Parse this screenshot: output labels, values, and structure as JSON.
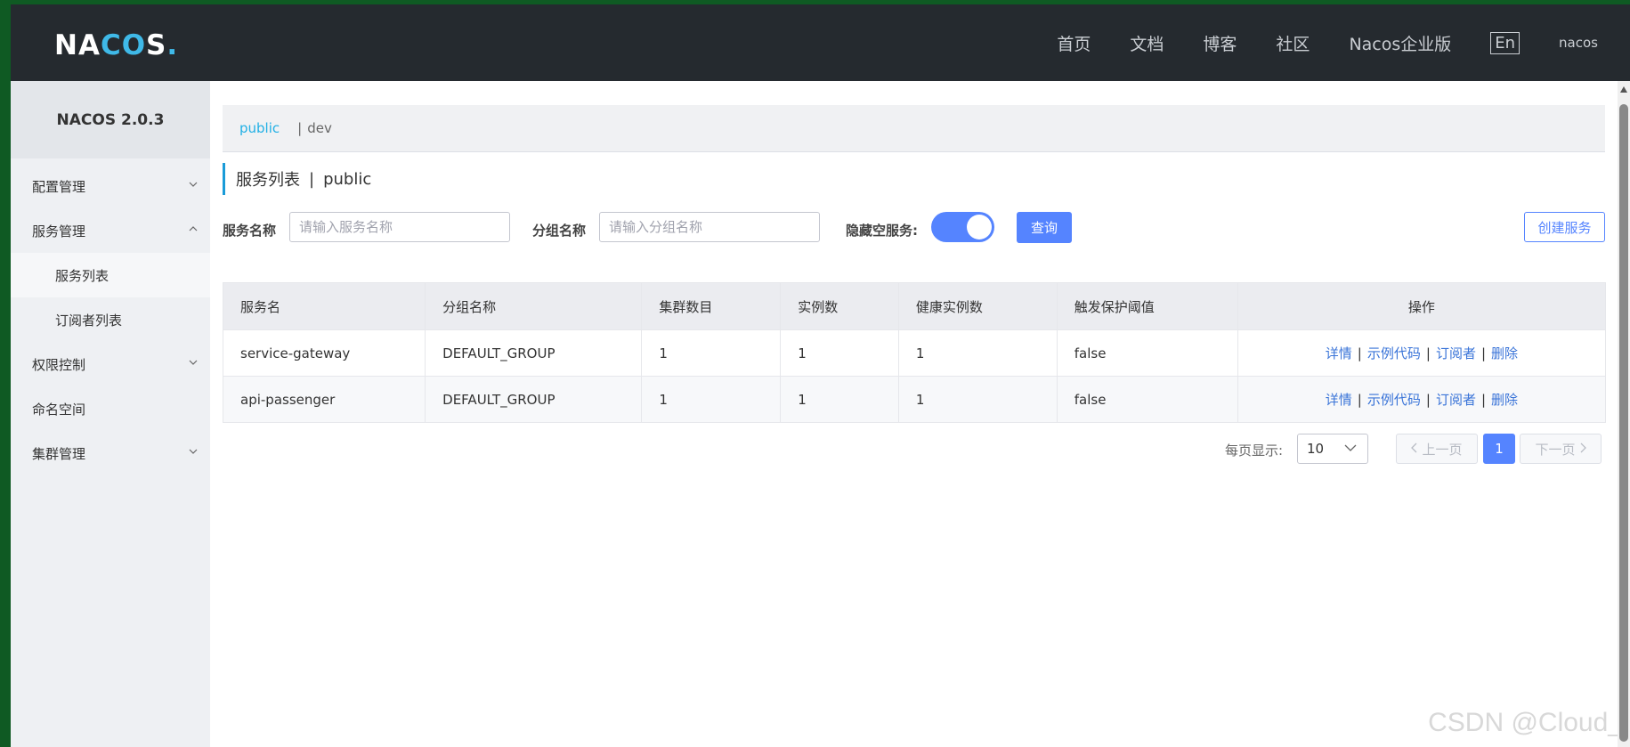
{
  "header": {
    "logo": {
      "pre": "NA",
      "accent": "CO",
      "post": "S",
      "dot": "."
    },
    "nav": [
      "首页",
      "文档",
      "博客",
      "社区",
      "Nacos企业版"
    ],
    "lang": "En",
    "user": "nacos"
  },
  "sidebar": {
    "title": "NACOS 2.0.3",
    "menu": {
      "config": "配置管理",
      "service": "服务管理",
      "service_list": "服务列表",
      "subscriber_list": "订阅者列表",
      "auth": "权限控制",
      "namespace": "命名空间",
      "cluster": "集群管理"
    }
  },
  "namespace_bar": {
    "active": "public",
    "sep": "|",
    "other": "dev"
  },
  "page_title": {
    "title": "服务列表",
    "sep": "|",
    "namespace": "public"
  },
  "filters": {
    "service_name_label": "服务名称",
    "service_name_placeholder": "请输入服务名称",
    "group_name_label": "分组名称",
    "group_name_placeholder": "请输入分组名称",
    "hide_empty_label": "隐藏空服务:",
    "hide_empty_on": true,
    "query_button": "查询",
    "create_button": "创建服务"
  },
  "table": {
    "headers": [
      "服务名",
      "分组名称",
      "集群数目",
      "实例数",
      "健康实例数",
      "触发保护阈值",
      "操作"
    ],
    "rows": [
      {
        "name": "service-gateway",
        "group": "DEFAULT_GROUP",
        "clusters": "1",
        "instances": "1",
        "healthy": "1",
        "threshold": "false"
      },
      {
        "name": "api-passenger",
        "group": "DEFAULT_GROUP",
        "clusters": "1",
        "instances": "1",
        "healthy": "1",
        "threshold": "false"
      }
    ],
    "ops": {
      "detail": "详情",
      "sample": "示例代码",
      "subscriber": "订阅者",
      "delete": "删除",
      "sep": "|"
    }
  },
  "pagination": {
    "page_size_label": "每页显示:",
    "page_size": "10",
    "prev": "上一页",
    "current": "1",
    "next": "下一页"
  },
  "watermark": "CSDN @Cloud_"
}
